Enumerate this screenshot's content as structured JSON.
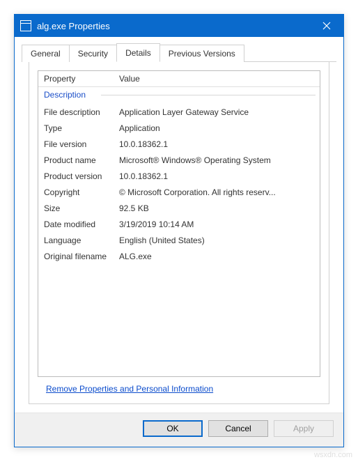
{
  "window": {
    "title": "alg.exe Properties"
  },
  "tabs": {
    "general": "General",
    "security": "Security",
    "details": "Details",
    "previous": "Previous Versions"
  },
  "headers": {
    "property": "Property",
    "value": "Value"
  },
  "section": {
    "description": "Description"
  },
  "props": {
    "file_description": {
      "label": "File description",
      "value": "Application Layer Gateway Service"
    },
    "type": {
      "label": "Type",
      "value": "Application"
    },
    "file_version": {
      "label": "File version",
      "value": "10.0.18362.1"
    },
    "product_name": {
      "label": "Product name",
      "value": "Microsoft® Windows® Operating System"
    },
    "product_version": {
      "label": "Product version",
      "value": "10.0.18362.1"
    },
    "copyright": {
      "label": "Copyright",
      "value": "© Microsoft Corporation. All rights reserv..."
    },
    "size": {
      "label": "Size",
      "value": "92.5 KB"
    },
    "date_modified": {
      "label": "Date modified",
      "value": "3/19/2019 10:14 AM"
    },
    "language": {
      "label": "Language",
      "value": "English (United States)"
    },
    "original_filename": {
      "label": "Original filename",
      "value": "ALG.exe"
    }
  },
  "link": {
    "remove": "Remove Properties and Personal Information"
  },
  "buttons": {
    "ok": "OK",
    "cancel": "Cancel",
    "apply": "Apply"
  },
  "watermark": "wsxdn.com"
}
